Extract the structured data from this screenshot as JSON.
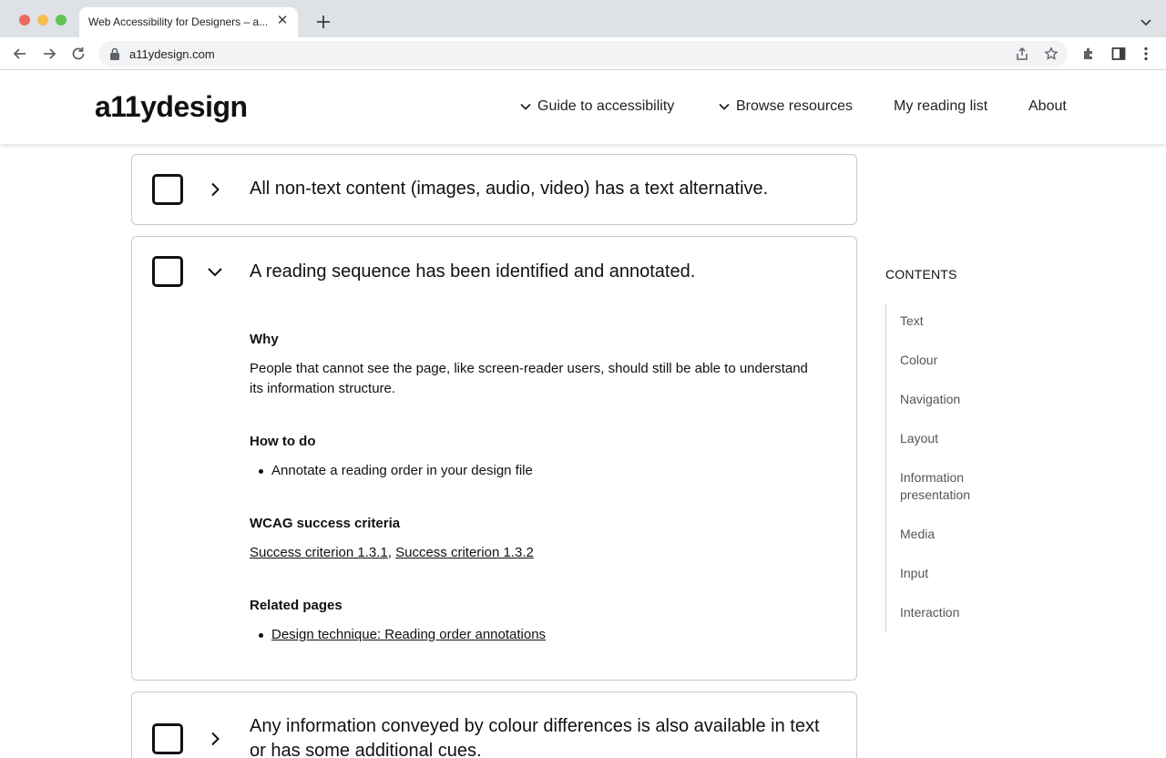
{
  "browser": {
    "tab_title": "Web Accessibility for Designers – a...",
    "tab_close": "✕",
    "url": "a11ydesign.com"
  },
  "header": {
    "logo": "a11ydesign",
    "nav": [
      {
        "label": "Guide to accessibility",
        "dropdown": true
      },
      {
        "label": "Browse resources",
        "dropdown": true
      },
      {
        "label": "My reading list",
        "dropdown": false
      },
      {
        "label": "About",
        "dropdown": false
      }
    ]
  },
  "checklist": [
    {
      "title": "All non-text content (images, audio, video) has a text alternative.",
      "expanded": false,
      "checked": false
    },
    {
      "title": "A reading sequence has been identified and annotated.",
      "expanded": true,
      "checked": false,
      "why_heading": "Why",
      "why_text": "People that cannot see the page, like screen-reader users, should still be able to understand its information structure.",
      "how_heading": "How to do",
      "how_items": [
        "Annotate a reading order in your design file"
      ],
      "wcag_heading": "WCAG success criteria",
      "wcag_links": [
        "Success criterion 1.3.1",
        "Success criterion 1.3.2"
      ],
      "wcag_separator": ",",
      "related_heading": "Related pages",
      "related_links": [
        "Design technique: Reading order annotations"
      ]
    },
    {
      "title": "Any information conveyed by colour differences is also available in text or has some additional cues.",
      "expanded": false,
      "checked": false
    }
  ],
  "contents": {
    "title": "CONTENTS",
    "items": [
      "Text",
      "Colour",
      "Navigation",
      "Layout",
      "Information presentation",
      "Media",
      "Input",
      "Interaction"
    ]
  },
  "colors": {
    "tabbar": "#dee1e6",
    "card_border": "#c8c8c8",
    "toc_rail": "#cfcfcf"
  }
}
